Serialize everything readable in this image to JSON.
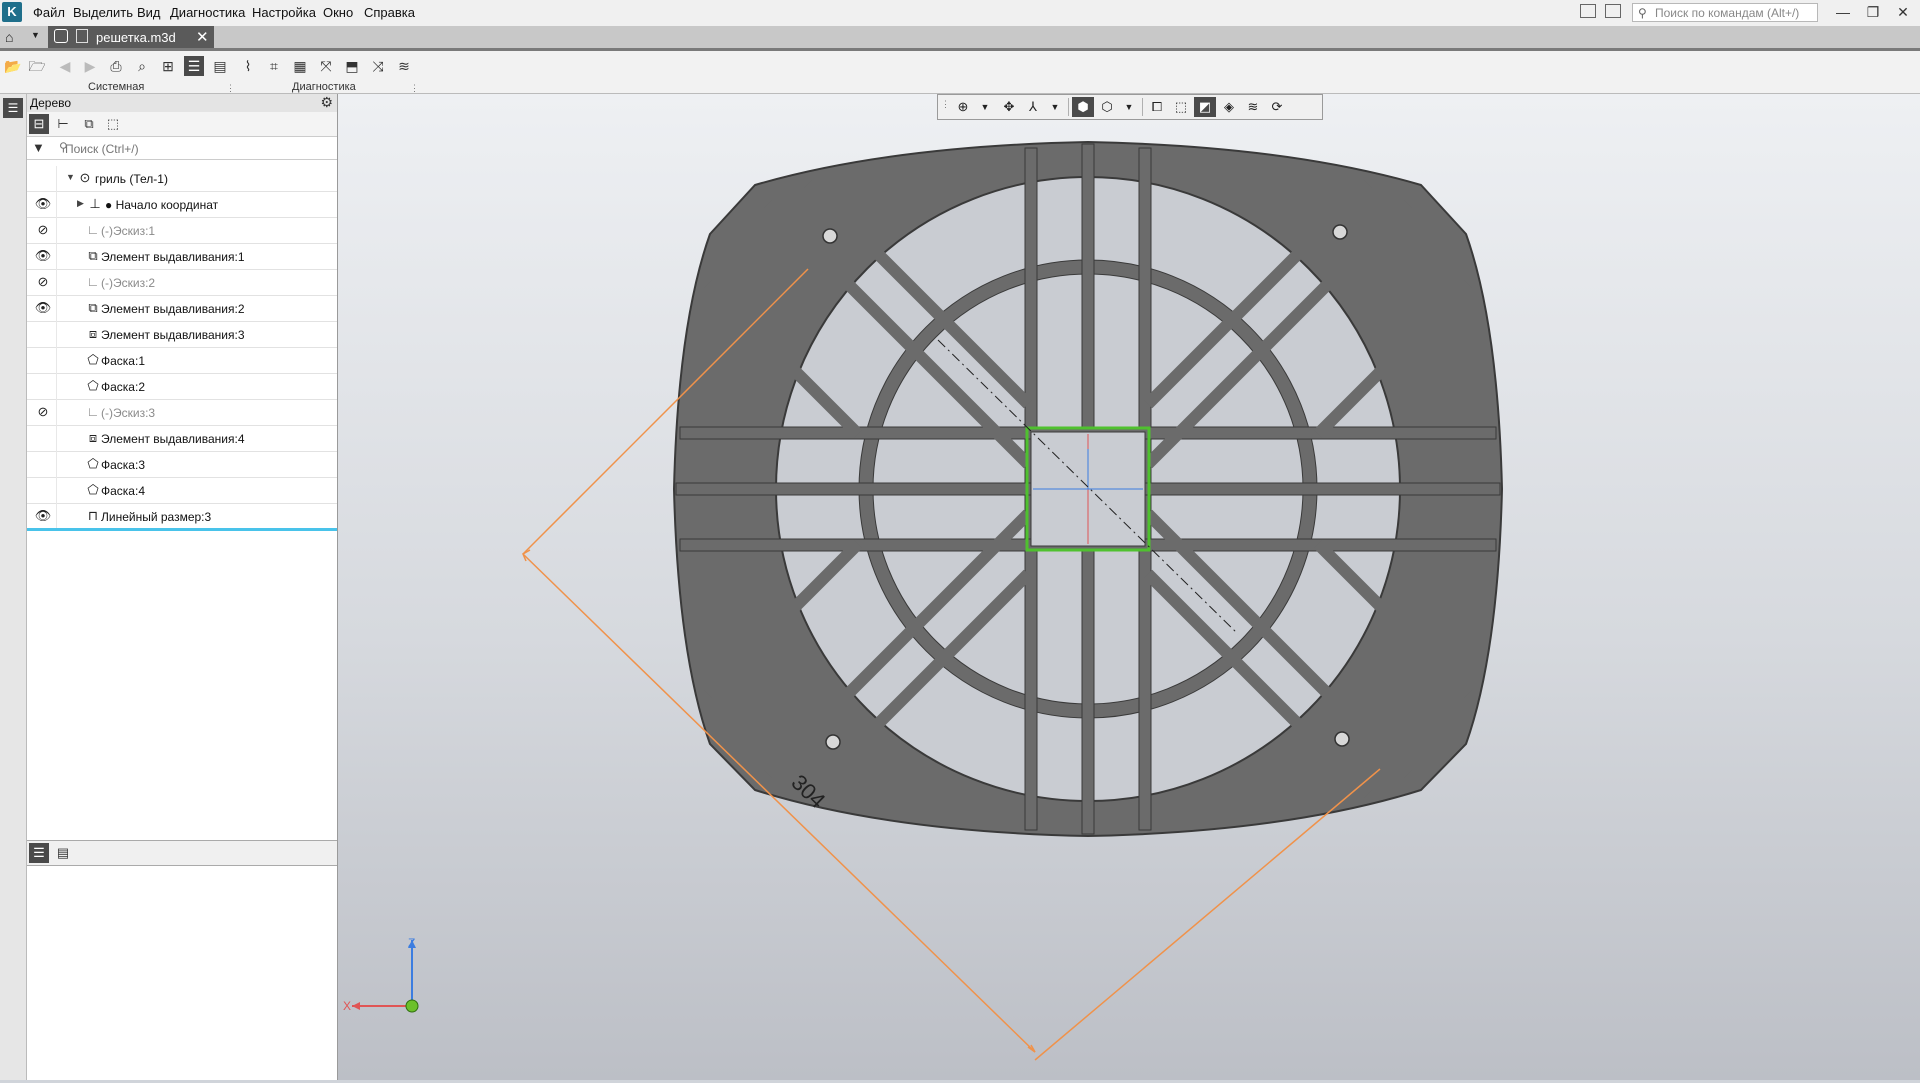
{
  "menu": {
    "items": [
      "Файл",
      "Выделить",
      "Вид",
      "Диагностика",
      "Настройка",
      "Окно",
      "Справка"
    ],
    "search_placeholder": "Поиск по командам (Alt+/)"
  },
  "tabs": {
    "document": "решетка.m3d"
  },
  "toolbar": {
    "group_system": "Системная",
    "group_diagnostics": "Диагностика"
  },
  "tree_panel": {
    "title": "Дерево",
    "search_placeholder": "Поиск (Ctrl+/)",
    "root": "гриль (Тел-1)",
    "items": [
      {
        "label": "Начало координат",
        "eye": "",
        "icon": "origin-icon"
      },
      {
        "label": "(-)Эскиз:1",
        "eye": "hidden",
        "icon": "sketch-icon"
      },
      {
        "label": "Элемент выдавливания:1",
        "eye": "visible",
        "icon": "extrude-icon"
      },
      {
        "label": "(-)Эскиз:2",
        "eye": "hidden",
        "icon": "sketch-icon"
      },
      {
        "label": "Элемент выдавливания:2",
        "eye": "visible",
        "icon": "extrude-icon"
      },
      {
        "label": "Элемент выдавливания:3",
        "eye": "",
        "icon": "extrude-icon"
      },
      {
        "label": "Фаска:1",
        "eye": "",
        "icon": "chamfer-icon"
      },
      {
        "label": "Фаска:2",
        "eye": "",
        "icon": "chamfer-icon"
      },
      {
        "label": "(-)Эскиз:3",
        "eye": "hidden",
        "icon": "sketch-icon"
      },
      {
        "label": "Элемент выдавливания:4",
        "eye": "",
        "icon": "extrude-icon"
      },
      {
        "label": "Фаска:3",
        "eye": "",
        "icon": "chamfer-icon"
      },
      {
        "label": "Фаска:4",
        "eye": "",
        "icon": "chamfer-icon"
      },
      {
        "label": "Линейный размер:3",
        "eye": "visible",
        "icon": "dimension-icon"
      }
    ]
  },
  "model": {
    "dimension_value": "304",
    "axis_z": "Z",
    "axis_x": "X"
  },
  "colors": {
    "model_fill": "#6b6b6b",
    "model_edge": "#3a3a3a",
    "dimension": "#f0924a",
    "selection": "#4fc12f",
    "tree_selection": "#49c3ea"
  }
}
